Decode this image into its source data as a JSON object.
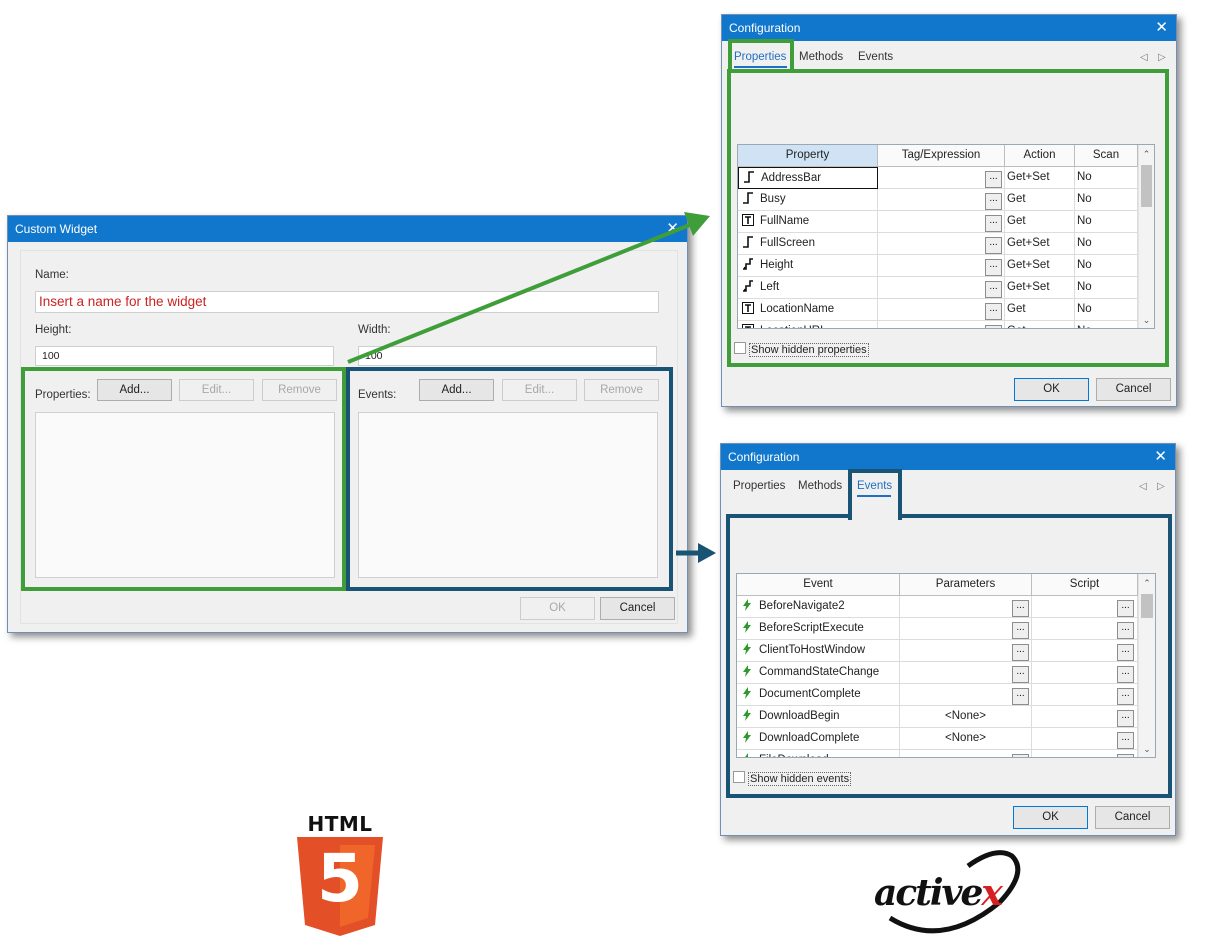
{
  "custom_widget": {
    "title": "Custom Widget",
    "close_glyph": "✕",
    "name_label": "Name:",
    "name_placeholder": "Insert a name for the widget",
    "height_label": "Height:",
    "height_value": "100",
    "width_label": "Width:",
    "width_value": "100",
    "properties_label": "Properties:",
    "events_label": "Events:",
    "add_label": "Add...",
    "edit_label": "Edit...",
    "remove_label": "Remove",
    "ok_label": "OK",
    "cancel_label": "Cancel"
  },
  "config_properties": {
    "title": "Configuration",
    "close_glyph": "✕",
    "tabs": [
      "Properties",
      "Methods",
      "Events"
    ],
    "active_tab": "Properties",
    "columns": [
      "Property",
      "Tag/Expression",
      "Action",
      "Scan"
    ],
    "rows": [
      {
        "icon": "step-icon",
        "name": "AddressBar",
        "action": "Get+Set",
        "scan": "No"
      },
      {
        "icon": "step-icon",
        "name": "Busy",
        "action": "Get",
        "scan": "No"
      },
      {
        "icon": "text-icon",
        "name": "FullName",
        "action": "Get",
        "scan": "No"
      },
      {
        "icon": "step-icon",
        "name": "FullScreen",
        "action": "Get+Set",
        "scan": "No"
      },
      {
        "icon": "numeric-icon",
        "name": "Height",
        "action": "Get+Set",
        "scan": "No"
      },
      {
        "icon": "numeric-icon",
        "name": "Left",
        "action": "Get+Set",
        "scan": "No"
      },
      {
        "icon": "text-icon",
        "name": "LocationName",
        "action": "Get",
        "scan": "No"
      },
      {
        "icon": "text-icon",
        "name": "LocationURL",
        "action": "Get",
        "scan": "No"
      }
    ],
    "show_hidden_label": "Show hidden properties",
    "ok_label": "OK",
    "cancel_label": "Cancel"
  },
  "config_events": {
    "title": "Configuration",
    "close_glyph": "✕",
    "tabs": [
      "Properties",
      "Methods",
      "Events"
    ],
    "active_tab": "Events",
    "columns": [
      "Event",
      "Parameters",
      "Script"
    ],
    "rows": [
      {
        "name": "BeforeNavigate2",
        "parameters": ""
      },
      {
        "name": "BeforeScriptExecute",
        "parameters": ""
      },
      {
        "name": "ClientToHostWindow",
        "parameters": ""
      },
      {
        "name": "CommandStateChange",
        "parameters": ""
      },
      {
        "name": "DocumentComplete",
        "parameters": ""
      },
      {
        "name": "DownloadBegin",
        "parameters": "<None>"
      },
      {
        "name": "DownloadComplete",
        "parameters": "<None>"
      },
      {
        "name": "FileDownload",
        "parameters": ""
      }
    ],
    "show_hidden_label": "Show hidden events",
    "ok_label": "OK",
    "cancel_label": "Cancel"
  },
  "logos": {
    "html5_word": "HTML",
    "html5_digit": "5",
    "activex_word": "activex"
  },
  "colors": {
    "title_bar": "#1177cc",
    "highlight_green": "#3f9e3a",
    "highlight_navy": "#1a5474",
    "placeholder_red": "#cc2222",
    "html5_orange": "#e34f26"
  }
}
